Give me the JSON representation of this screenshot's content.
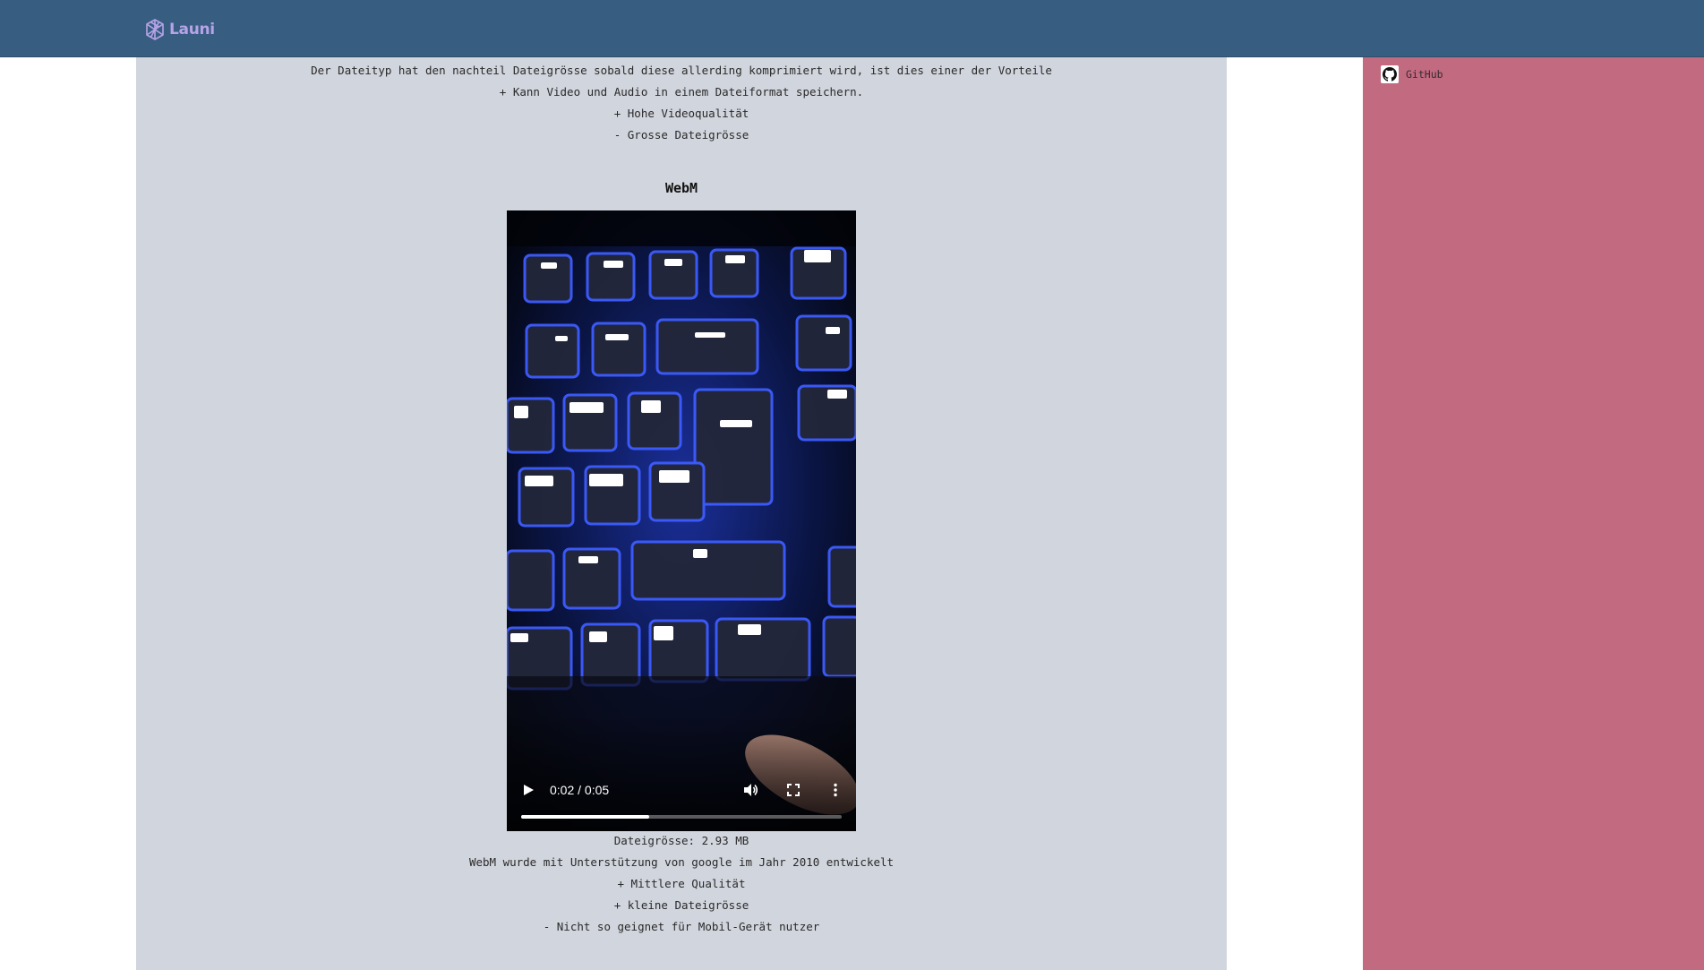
{
  "header": {
    "logo_text": "Launi",
    "logo_color": "#b7a3e8",
    "background": "#375e80"
  },
  "mp4_section": {
    "lines": [
      "Der Dateityp hat den nachteil Dateigrösse sobald diese allerding komprimiert wird, ist dies einer der Vorteile",
      "+ Kann Video und Audio in einem Dateiformat speichern.",
      "+ Hohe Videoqualität",
      "- Grosse Dateigrösse"
    ]
  },
  "webm_section": {
    "title": "WebM",
    "video": {
      "time_display": "0:02 / 0:05",
      "progress": 0.4
    },
    "lines": [
      "Dateigrösse: 2.93 MB",
      "WebM wurde mit Unterstützung von google im Jahr 2010 entwickelt",
      "+ Mittlere Qualität",
      "+ kleine Dateigrösse",
      "- Nicht so geignet für Mobil-Gerät nutzer"
    ]
  },
  "sidebar": {
    "github_label": "GitHub",
    "background": "#c26a80"
  }
}
